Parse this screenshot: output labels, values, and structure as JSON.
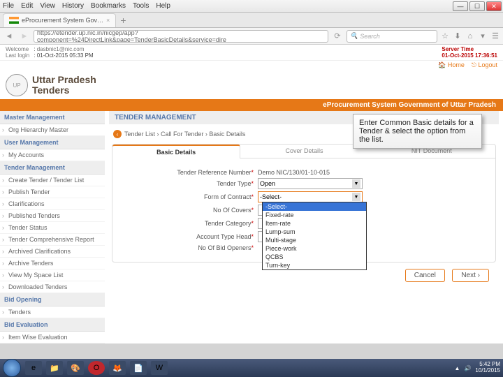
{
  "menu": {
    "file": "File",
    "edit": "Edit",
    "view": "View",
    "history": "History",
    "bookmarks": "Bookmarks",
    "tools": "Tools",
    "help": "Help"
  },
  "tab": {
    "title": "eProcurement System Gov…"
  },
  "url": "https://etender.up.nic.in/nicgep/app?component=%24DirectLink&page=TenderBasicDetails&service=dire",
  "search_placeholder": "Search",
  "topinfo": {
    "welcome_label": "Welcome",
    "lastlogin_label": "Last login",
    "email": "dasbnic1@nic.com",
    "lastlogin": "01-Oct-2015 05:33 PM",
    "servertime_label": "Server Time",
    "servertime": "01-Oct-2015 17:36:51"
  },
  "home": "Home",
  "logout": "Logout",
  "brand": {
    "line1": "Uttar Pradesh",
    "line2": "Tenders"
  },
  "orangebar": "eProcurement System Government of Uttar Pradesh",
  "sidebar": {
    "s1": "Master Management",
    "i1": "Org Hierarchy Master",
    "s2": "User Management",
    "i2": "My Accounts",
    "s3": "Tender Management",
    "i3": "Create Tender / Tender List",
    "i4": "Publish Tender",
    "i5": "Clarifications",
    "i6": "Published Tenders",
    "i7": "Tender Status",
    "i8": "Tender Comprehensive Report",
    "i9": "Archived Clarifications",
    "i10": "Archive Tenders",
    "i11": "View My Space List",
    "i12": "Downloaded Tenders",
    "s4": "Bid Opening",
    "i13": "Tenders",
    "s5": "Bid Evaluation",
    "i14": "Item Wise Evaluation"
  },
  "crumb": {
    "title": "TENDER MANAGEMENT",
    "path": "Tender List › Call For Tender › Basic Details"
  },
  "tabs": {
    "t1": "Basic Details",
    "t2": "Cover Details",
    "t3": "NIT Document"
  },
  "form": {
    "ref_label": "Tender Reference Number",
    "ref_val": "Demo NIC/130/01-10-015",
    "type_label": "Tender Type",
    "type_val": "Open",
    "foc_label": "Form of Contract",
    "foc_val": "-Select-",
    "covers_label": "No Of Covers",
    "covers_val": "",
    "cat_label": "Tender Category",
    "cat_val": "",
    "acct_label": "Account Type Head",
    "acct_val": "",
    "bidopen_label": "No Of Bid Openers"
  },
  "dropdown": [
    "-Select-",
    "Fixed-rate",
    "Item-rate",
    "Lump-sum",
    "Multi-stage",
    "Piece-work",
    "QCBS",
    "Turn-key"
  ],
  "callout": "Enter Common Basic details for a Tender & select the option from the list.",
  "btn": {
    "cancel": "Cancel",
    "next": "Next ›"
  },
  "clock": {
    "time": "5:42 PM",
    "date": "10/1/2015"
  }
}
